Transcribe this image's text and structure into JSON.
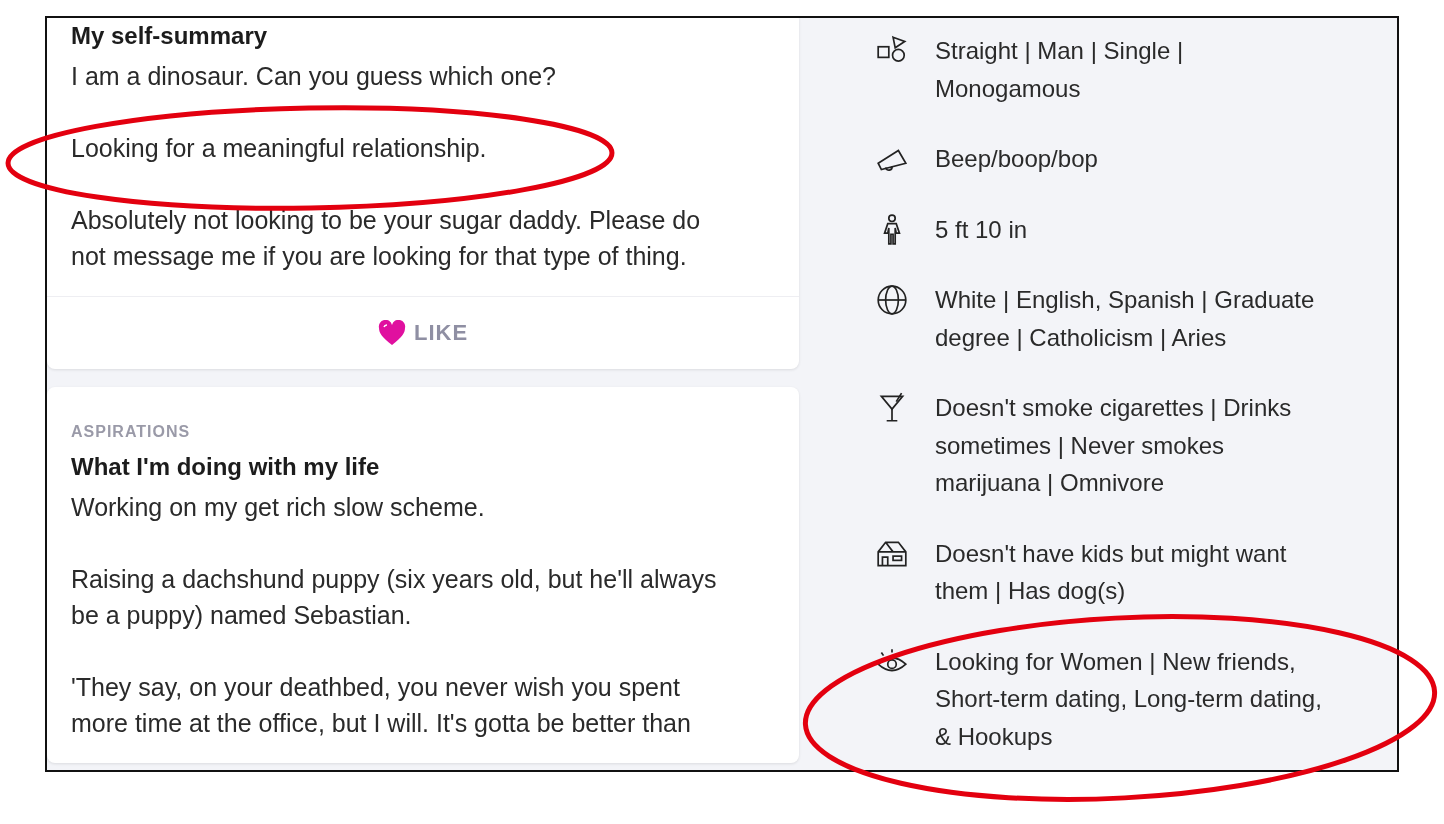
{
  "essays": [
    {
      "title": "My self-summary",
      "paragraphs": [
        "I am a dinosaur. Can you guess which one?",
        "Looking for a meaningful relationship.",
        "Absolutely not looking to be your sugar daddy. Please do not message me if you are looking for that type of thing."
      ],
      "like_button": {
        "label": "LIKE"
      }
    },
    {
      "section_label": "ASPIRATIONS",
      "title": "What I'm doing with my life",
      "paragraphs": [
        "Working on my get rich slow scheme.",
        "Raising a dachshund puppy (six years old, but he'll always be a puppy) named Sebastian.",
        "'They say, on your deathbed, you never wish you spent more time at the office, but I will. It's gotta be better than"
      ]
    }
  ],
  "details": [
    {
      "kind": "shapes",
      "text": "Straight | Man | Single | Monogamous"
    },
    {
      "kind": "megaphone",
      "text": "Beep/boop/bop"
    },
    {
      "kind": "person",
      "text": "5 ft 10 in"
    },
    {
      "kind": "globe",
      "text": "White | English, Spanish | Graduate degree | Catholicism | Aries"
    },
    {
      "kind": "cocktail",
      "text": "Doesn't smoke cigarettes | Drinks sometimes | Never smokes marijuana | Omnivore"
    },
    {
      "kind": "house",
      "text": "Doesn't have kids but might want them | Has dog(s)"
    },
    {
      "kind": "eye",
      "text": "Looking for Women | New friends, Short-term dating, Long-term dating, & Hookups"
    }
  ],
  "annotations": [
    {
      "kind": "ellipse"
    },
    {
      "kind": "ellipse"
    }
  ]
}
